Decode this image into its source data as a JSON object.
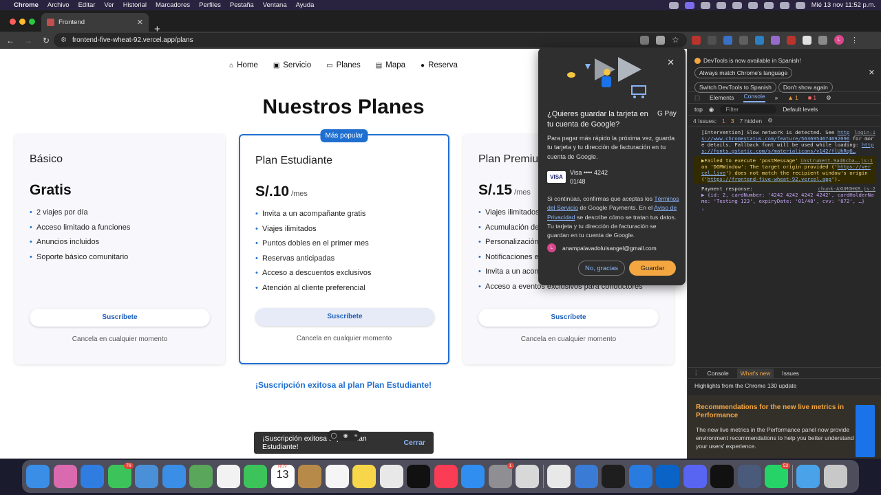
{
  "menubar": {
    "app": "Chrome",
    "menus": [
      "Archivo",
      "Editar",
      "Ver",
      "Historial",
      "Marcadores",
      "Perfiles",
      "Pestaña",
      "Ventana",
      "Ayuda"
    ],
    "clock": "Mié 13 nov 11:52 p.m."
  },
  "browser": {
    "tab_title": "Frontend",
    "url": "frontend-five-wheat-92.vercel.app/plans",
    "profile_initial": "L"
  },
  "site": {
    "nav": [
      {
        "label": "Home",
        "icon": "home-icon"
      },
      {
        "label": "Servicio",
        "icon": "car-icon"
      },
      {
        "label": "Planes",
        "icon": "monitor-icon"
      },
      {
        "label": "Mapa",
        "icon": "map-icon"
      },
      {
        "label": "Reserva",
        "icon": "person-icon"
      }
    ],
    "title": "Nuestros Planes",
    "plans": [
      {
        "name": "Básico",
        "price": "Gratis",
        "period": "",
        "features": [
          "2 viajes por día",
          "Acceso limitado a funciones",
          "Anuncios incluidos",
          "Soporte básico comunitario"
        ],
        "button": "Suscríbete",
        "note": "Cancela en cualquier momento"
      },
      {
        "name": "Plan Estudiante",
        "price": "S/.10",
        "period": "/mes",
        "badge": "Más popular",
        "features": [
          "Invita a un acompañante gratis",
          "Viajes ilimitados",
          "Puntos dobles en el primer mes",
          "Reservas anticipadas",
          "Acceso a descuentos exclusivos",
          "Atención al cliente preferencial"
        ],
        "button": "Suscríbete",
        "note": "Cancela en cualquier momento"
      },
      {
        "name": "Plan Premium",
        "price": "S/.15",
        "period": "/mes",
        "features": [
          "Viajes ilimitados",
          "Acumulación de",
          "Personalización",
          "Notificaciones e",
          "Invita a un acom",
          "Acceso a eventos exclusivos para conductores"
        ],
        "button": "Suscríbete",
        "note": "Cancela en cualquier momento"
      }
    ],
    "success_message": "¡Suscripción exitosa al plan Plan Estudiante!",
    "snackbar": {
      "text": "¡Suscripción exitosa al plan Plan Estudiante!",
      "action": "Cerrar"
    }
  },
  "gpay": {
    "title": "¿Quieres guardar la tarjeta en tu cuenta de Google?",
    "logo": "G Pay",
    "description": "Para pagar más rápido la próxima vez, guarda tu tarjeta y tu dirección de facturación en tu cuenta de Google.",
    "card_brand": "VISA",
    "card_label": "Visa  •••• 4242",
    "card_expiry": "01/48",
    "terms_pre": "Si continúas, confirmas que aceptas los ",
    "terms_link1": "Términos del Servicio",
    "terms_mid": " de Google Payments. En el ",
    "terms_link2": "Aviso de Privacidad",
    "terms_post": " se describe cómo se tratan tus datos. Tu tarjeta y tu dirección de facturación se guardan en tu cuenta de Google.",
    "account_initial": "L",
    "account_email": "anampalavadoluisangel@gmail.com",
    "decline": "No, gracias",
    "accept": "Guardar"
  },
  "devtools": {
    "banner": "DevTools is now available in Spanish!",
    "banner_buttons": [
      "Always match Chrome's language",
      "Switch DevTools to Spanish",
      "Don't show again"
    ],
    "tabs": [
      "Elements",
      "Console"
    ],
    "warn_count": "1",
    "err_count": "1",
    "context": "top",
    "filter_placeholder": "Filter",
    "levels": "Default levels",
    "issues": "4 Issues:",
    "issues_err": "1",
    "issues_warn": "3",
    "hidden": "7 hidden",
    "log": [
      {
        "src": "login:1",
        "text": "[Intervention] Slow network is detected. See ",
        "link": "https://www.chromestatus.com/feature/5636954674692096",
        "rest": " for more details. Fallback font will be used while loading: ",
        "link2": "https://fonts.gstatic.com/s/materialicons/v142/flUhRq6…"
      },
      {
        "src": "instrument.9ad6cba….js:1",
        "text": "▶Failed to execute 'postMessage' on 'DOMWindow': The target origin provided ('",
        "link": "https://vercel.live",
        "rest": "') does not match the recipient window's origin ('",
        "link2": "https://frontend-five-wheat-92.vercel.app",
        "end": "')."
      },
      {
        "src": "chunk-AXUMOHKB.js:2",
        "text": "Payment response:",
        "detail": "▶ {id: 2, cardNumber: '4242 4242 4242 4242', cardHolderName: 'Testing 123', expiryDate: '01/48', cvv: '872', …}"
      }
    ],
    "drawer_tabs": [
      "Console",
      "What's new",
      "Issues"
    ],
    "highlight": "Highlights from the Chrome 130 update",
    "card_heading": "Recommendations for the new live metrics in Performance",
    "card_body": "The new live metrics in the Performance panel now provide environment recommendations to help you better understand your users' experience."
  },
  "dock": {
    "messages_badge": "76",
    "settings_badge": "1",
    "whatsapp_badge": "53",
    "calendar_month": "NOV",
    "calendar_day": "13"
  }
}
